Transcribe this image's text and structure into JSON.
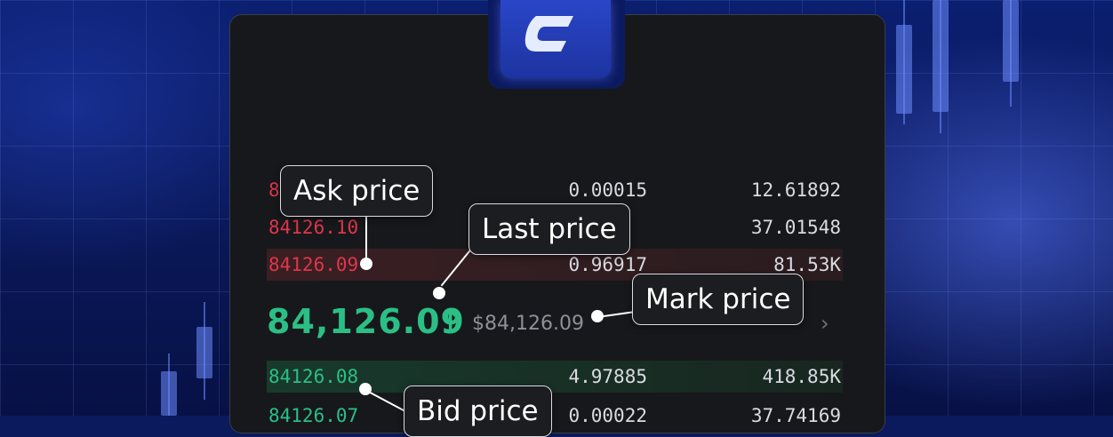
{
  "colors": {
    "ask_red": "#e0354b",
    "bid_green": "#2bbf86",
    "panel_bg": "#17181b",
    "brand_blue": "#1d33a0"
  },
  "logo": {
    "icon": "exchange-logo-icon"
  },
  "asks": [
    {
      "price": "8",
      "qty": "0.00015",
      "total": "12.61892"
    },
    {
      "price": "84126.10",
      "qty": "",
      "total": "37.01548"
    },
    {
      "price": "84126.09",
      "qty": "0.96917",
      "total": "81.53K"
    }
  ],
  "ticker": {
    "last_price": "84,126.09",
    "direction_icon": "arrow-up-icon",
    "mark_price": "$84,126.09",
    "more_icon": "chevron-right-icon"
  },
  "bids": [
    {
      "price": "84126.08",
      "qty": "4.97885",
      "total": "418.85K"
    },
    {
      "price": "84126.07",
      "qty": "0.00022",
      "total": "37.74169"
    }
  ],
  "callouts": {
    "ask": "Ask price",
    "last": "Last price",
    "mark": "Mark price",
    "bid": "Bid price"
  }
}
